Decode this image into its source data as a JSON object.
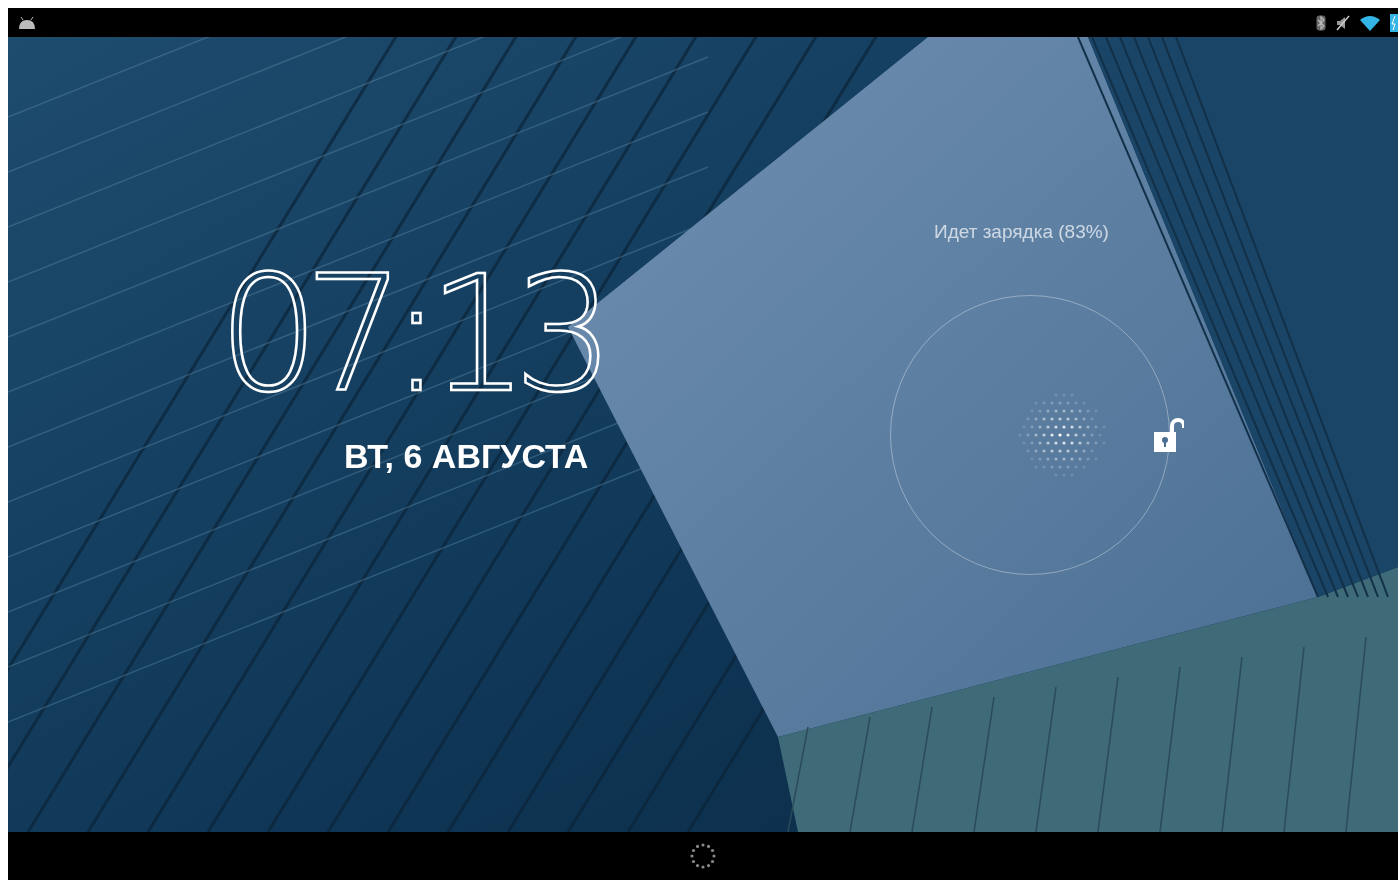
{
  "lock_screen": {
    "time": "07:13",
    "date": "ВТ, 6 АВГУСТА",
    "charging_status": "Идет зарядка (83%)"
  }
}
